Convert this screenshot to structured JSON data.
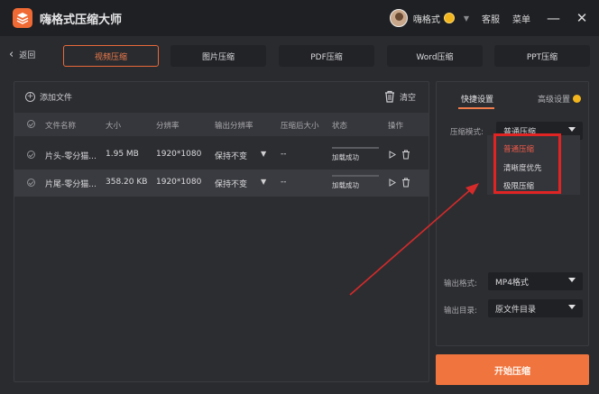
{
  "app": {
    "title": "嗨格式压缩大师"
  },
  "user": {
    "name": "嗨格式"
  },
  "top_links": {
    "service": "客服",
    "menu": "菜单"
  },
  "window": {
    "minimize": "—",
    "close": "✕"
  },
  "nav": {
    "back_label": "返回",
    "tabs": [
      {
        "label": "视频压缩",
        "active": true
      },
      {
        "label": "图片压缩",
        "active": false
      },
      {
        "label": "PDF压缩",
        "active": false
      },
      {
        "label": "Word压缩",
        "active": false
      },
      {
        "label": "PPT压缩",
        "active": false
      }
    ]
  },
  "file_panel": {
    "add_label": "添加文件",
    "clear_label": "清空",
    "columns": [
      "文件名称",
      "大小",
      "分辨率",
      "输出分辨率",
      "压缩后大小",
      "状态",
      "操作"
    ],
    "rows": [
      {
        "name": "片头-零分猫...",
        "size": "1.95 MB",
        "resolution": "1920*1080",
        "output_resolution": "保持不变",
        "compressed_size": "--",
        "status": "加载成功"
      },
      {
        "name": "片尾-零分猫...",
        "size": "358.20 KB",
        "resolution": "1920*1080",
        "output_resolution": "保持不变",
        "compressed_size": "--",
        "status": "加载成功"
      }
    ]
  },
  "settings_panel": {
    "tabs": {
      "quick": "快捷设置",
      "advanced": "高级设置"
    },
    "compress_mode": {
      "label": "压缩模式:",
      "value": "普通压缩",
      "options": [
        "普通压缩",
        "清晰度优先",
        "极限压缩"
      ],
      "selected_index": 0
    },
    "output_format": {
      "label": "输出格式:",
      "value": "MP4格式"
    },
    "output_dir": {
      "label": "输出目录:",
      "value": "原文件目录"
    }
  },
  "start_button": {
    "label": "开始压缩"
  },
  "colors": {
    "accent": "#f0743e",
    "highlight": "#e02424",
    "background": "#2a2b2f"
  }
}
